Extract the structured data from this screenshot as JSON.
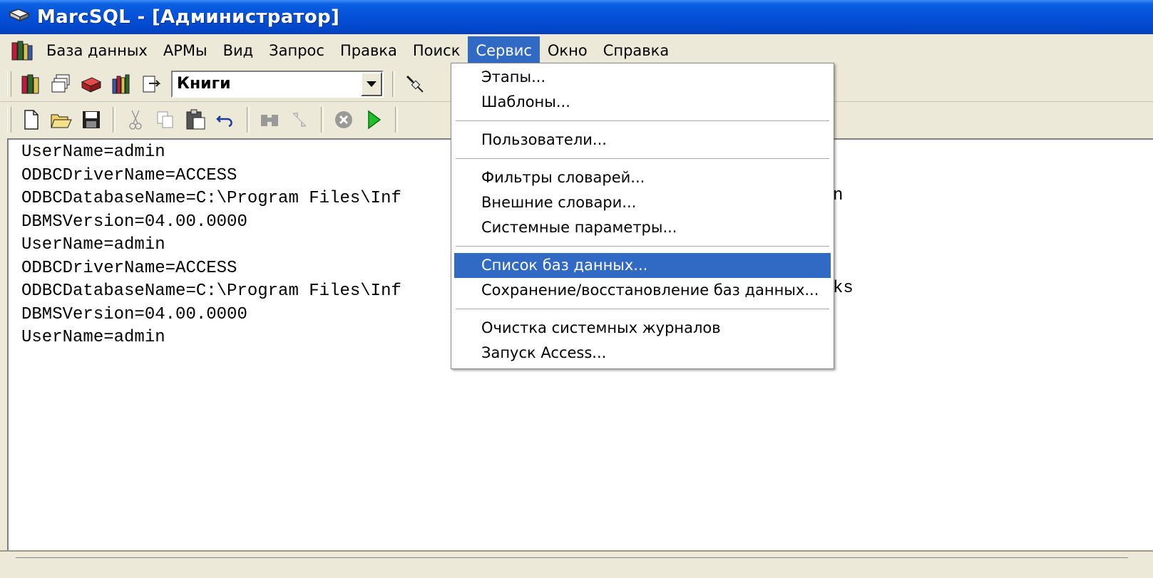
{
  "window": {
    "title": "MarcSQL - [Администратор]"
  },
  "menubar": {
    "items": [
      "База данных",
      "АРМы",
      "Вид",
      "Запрос",
      "Правка",
      "Поиск",
      "Сервис",
      "Окно",
      "Справка"
    ],
    "active": "Сервис"
  },
  "toolbar1": {
    "database_select": {
      "value": "Книги"
    }
  },
  "editor": {
    "lines": [
      "UserName=admin",
      "ODBCDriverName=ACCESS",
      "ODBCDatabaseName=C:\\Program Files\\Inf",
      "DBMSVersion=04.00.0000",
      "UserName=admin",
      "ODBCDriverName=ACCESS",
      "ODBCDatabaseName=C:\\Program Files\\Inf",
      "DBMSVersion=04.00.0000",
      "UserName=admin"
    ],
    "clipped_right": [
      "n",
      "ks"
    ]
  },
  "service_menu": {
    "groups": [
      [
        "Этапы...",
        "Шаблоны..."
      ],
      [
        "Пользователи..."
      ],
      [
        "Фильтры словарей...",
        "Внешние словари...",
        "Системные параметры..."
      ],
      [
        "Список баз данных...",
        "Сохранение/восстановление баз данных..."
      ],
      [
        "Очистка системных журналов",
        "Запуск Access..."
      ]
    ],
    "highlighted": "Список баз данных..."
  },
  "colors": {
    "titlebar": "#0550d9",
    "selection": "#316ac5",
    "chrome": "#ece9d8"
  }
}
